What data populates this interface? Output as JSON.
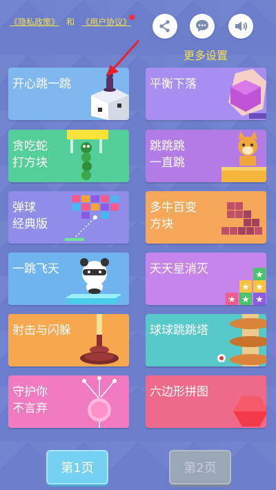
{
  "header": {
    "privacy_link": "《隐私政策》",
    "and_text": "和",
    "agreement_link": "《用户协议》",
    "more_settings": "更多设置",
    "icons": [
      "share-icon",
      "chat-icon",
      "speaker-icon"
    ]
  },
  "games": [
    {
      "title": "开心跳一跳",
      "color": "#7fb8f0"
    },
    {
      "title": "平衡下落",
      "color": "#a88ef0"
    },
    {
      "title": "贪吃蛇\n打方块",
      "color": "#55cf9a"
    },
    {
      "title": "跳跳跳\n一直跳",
      "color": "#b27be6"
    },
    {
      "title": "弹球\n经典版",
      "color": "#8f8de8"
    },
    {
      "title": "多牛百变\n方块",
      "color": "#f6a85a"
    },
    {
      "title": "一跳飞天",
      "color": "#6fb4ee"
    },
    {
      "title": "天天星消灭",
      "color": "#c784ea"
    },
    {
      "title": "射击与闪躲",
      "color": "#f7a84e"
    },
    {
      "title": "球球跳跳塔",
      "color": "#58c9c9"
    },
    {
      "title": "守护你\n不言弃",
      "color": "#f07ac0"
    },
    {
      "title": "六边形拼图",
      "color": "#ef6a8a"
    }
  ],
  "pagination": {
    "page1": "第1页",
    "page2": "第2页"
  }
}
